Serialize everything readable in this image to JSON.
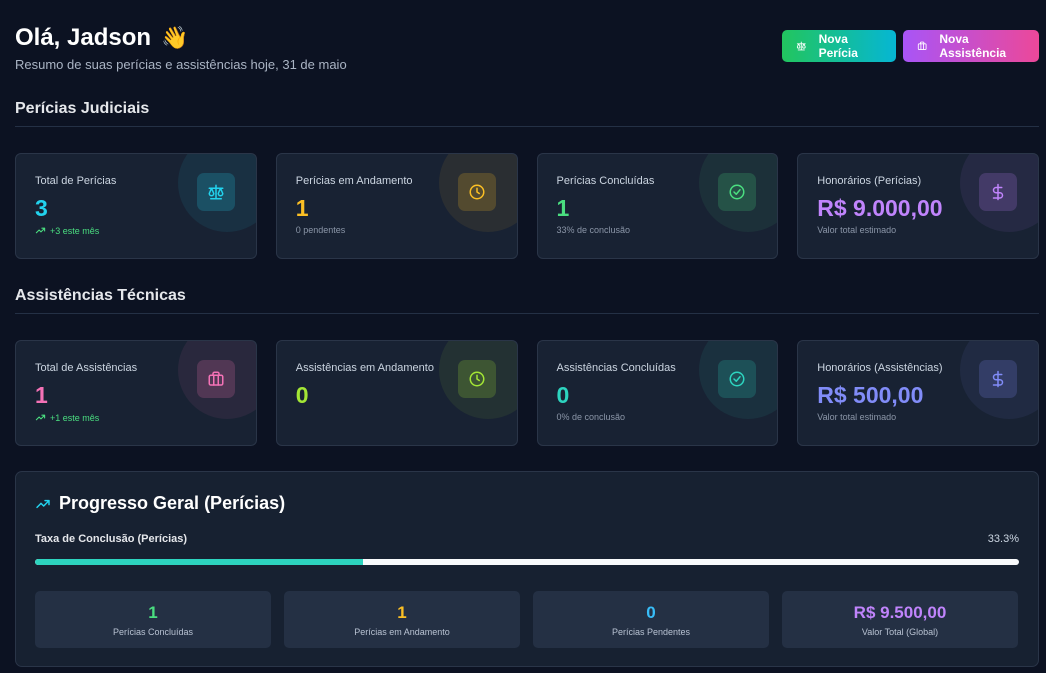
{
  "header": {
    "greeting": "Olá, Jadson",
    "wave": "👋",
    "subtitle": "Resumo de suas perícias e assistências hoje, 31 de maio",
    "new_pericia_label": "Nova Perícia",
    "new_assistencia_label": "Nova Assistência"
  },
  "pericias": {
    "title": "Perícias Judiciais",
    "cards": [
      {
        "label": "Total de Perícias",
        "value": "3",
        "note": "+3 este mês",
        "icon": "scale-icon",
        "color": "#22d3ee"
      },
      {
        "label": "Perícias em Andamento",
        "value": "1",
        "note": "0 pendentes",
        "icon": "clock-icon",
        "color": "#fbbf24"
      },
      {
        "label": "Perícias Concluídas",
        "value": "1",
        "note": "33% de conclusão",
        "icon": "check-circle-icon",
        "color": "#4ade80"
      },
      {
        "label": "Honorários (Perícias)",
        "value": "R$ 9.000,00",
        "note": "Valor total estimado",
        "icon": "dollar-icon",
        "color": "#c084fc"
      }
    ]
  },
  "assistencias": {
    "title": "Assistências Técnicas",
    "cards": [
      {
        "label": "Total de Assistências",
        "value": "1",
        "note": "+1 este mês",
        "icon": "briefcase-icon",
        "color": "#f472b6"
      },
      {
        "label": "Assistências em Andamento",
        "value": "0",
        "note": "",
        "icon": "clock-icon",
        "color": "#a3e635"
      },
      {
        "label": "Assistências Concluídas",
        "value": "0",
        "note": "0% de conclusão",
        "icon": "check-circle-icon",
        "color": "#2dd4bf"
      },
      {
        "label": "Honorários (Assistências)",
        "value": "R$ 500,00",
        "note": "Valor total estimado",
        "icon": "dollar-icon",
        "color": "#818cf8"
      }
    ]
  },
  "progress": {
    "title": "Progresso Geral (Perícias)",
    "rate_label": "Taxa de Conclusão (Perícias)",
    "rate_value": "33.3%",
    "rate_fraction": 0.333,
    "stats": [
      {
        "value": "1",
        "label": "Perícias Concluídas",
        "color": "#4ade80"
      },
      {
        "value": "1",
        "label": "Perícias em Andamento",
        "color": "#fbbf24"
      },
      {
        "value": "0",
        "label": "Perícias Pendentes",
        "color": "#38bdf8"
      },
      {
        "value": "R$ 9.500,00",
        "label": "Valor Total (Global)",
        "color": "#c084fc"
      }
    ]
  }
}
